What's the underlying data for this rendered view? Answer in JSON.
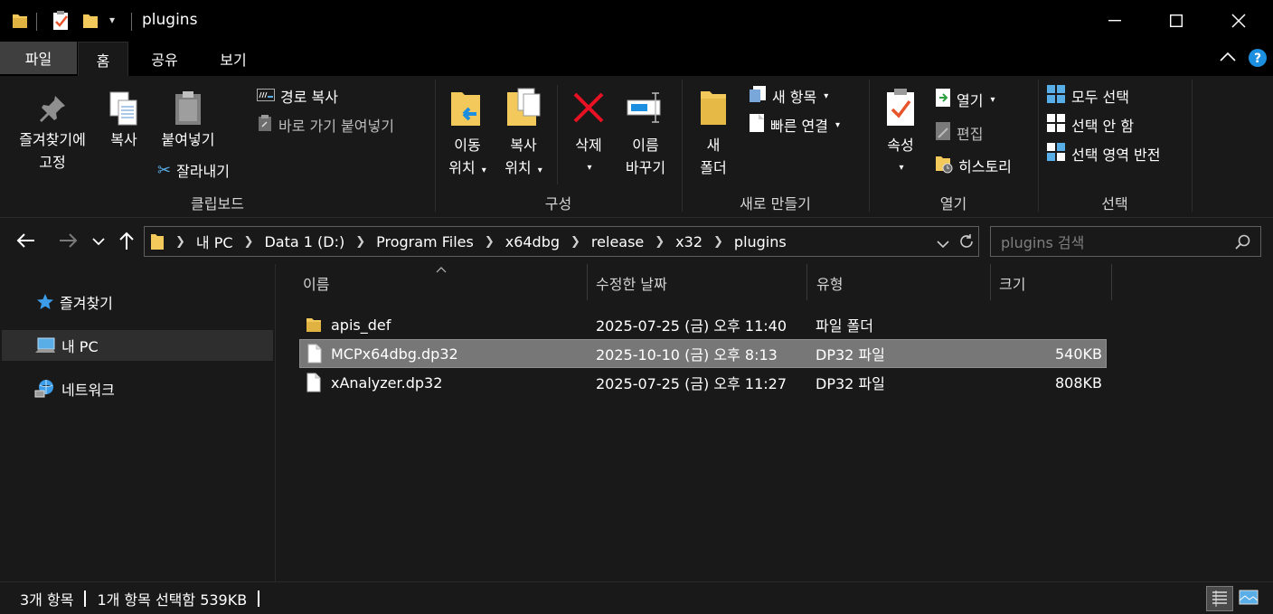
{
  "window": {
    "title": "plugins",
    "minimize_glyph": "—",
    "maximize_glyph": "☐",
    "close_glyph": "✕"
  },
  "ribbon_tabs": [
    "파일",
    "홈",
    "공유",
    "보기"
  ],
  "ribbon": {
    "clipboard": {
      "group_label": "클립보드",
      "pin_label_1": "즐겨찾기에",
      "pin_label_2": "고정",
      "copy_label": "복사",
      "paste_label": "붙여넣기",
      "copy_path_label": "경로 복사",
      "paste_shortcut_label": "바로 가기 붙여넣기",
      "cut_label": "잘라내기"
    },
    "organize": {
      "group_label": "구성",
      "move_label_1": "이동",
      "move_label_2": "위치",
      "copyto_label_1": "복사",
      "copyto_label_2": "위치",
      "delete_label": "삭제",
      "rename_label_1": "이름",
      "rename_label_2": "바꾸기"
    },
    "new": {
      "group_label": "새로 만들기",
      "new_folder_label_1": "새",
      "new_folder_label_2": "폴더",
      "new_item_label": "새 항목",
      "easy_access_label": "빠른 연결"
    },
    "open": {
      "group_label": "열기",
      "properties_label": "속성",
      "open_label": "열기",
      "edit_label": "편집",
      "history_label": "히스토리"
    },
    "select": {
      "group_label": "선택",
      "select_all_label": "모두 선택",
      "select_none_label": "선택 안 함",
      "invert_label": "선택 영역 반전"
    }
  },
  "address": {
    "crumbs": [
      "내 PC",
      "Data 1 (D:)",
      "Program Files",
      "x64dbg",
      "release",
      "x32",
      "plugins"
    ],
    "search_placeholder": "plugins 검색"
  },
  "nav": [
    {
      "label": "즐겨찾기",
      "icon": "star-icon"
    },
    {
      "label": "내 PC",
      "icon": "pc-icon"
    },
    {
      "label": "네트워크",
      "icon": "network-icon"
    }
  ],
  "columns": [
    "이름",
    "수정한 날짜",
    "유형",
    "크기"
  ],
  "files": [
    {
      "name": "apis_def",
      "date": "2025-07-25 (금) 오후 11:40",
      "type": "파일 폴더",
      "size": "",
      "kind": "folder"
    },
    {
      "name": "MCPx64dbg.dp32",
      "date": "2025-10-10 (금) 오후 8:13",
      "type": "DP32 파일",
      "size": "540KB",
      "kind": "file"
    },
    {
      "name": "xAnalyzer.dp32",
      "date": "2025-07-25 (금) 오후 11:27",
      "type": "DP32 파일",
      "size": "808KB",
      "kind": "file"
    }
  ],
  "status": {
    "count": "3개 항목",
    "selection": "1개 항목 선택함 539KB"
  },
  "colors": {
    "folder": "#f3c95c",
    "accent_blue": "#1d8fe0",
    "delete_red": "#e81123",
    "selection_row": "#777777"
  }
}
